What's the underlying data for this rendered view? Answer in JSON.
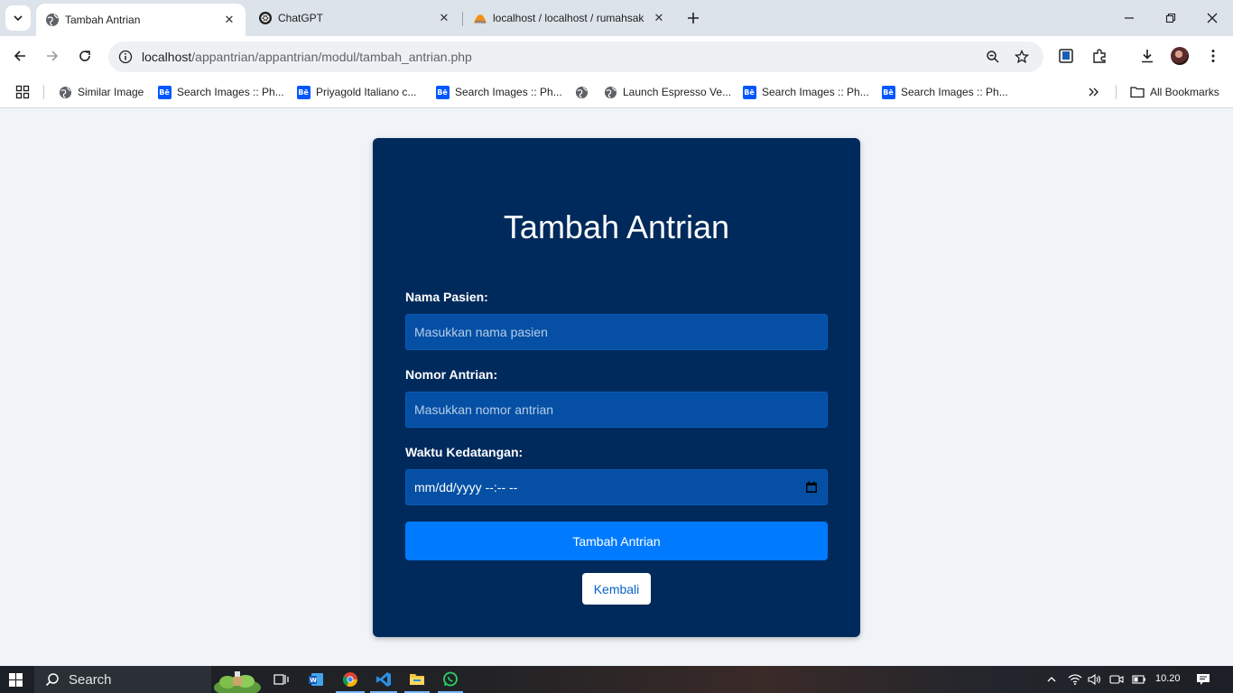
{
  "browser": {
    "tabs": [
      {
        "title": "Tambah Antrian",
        "active": true,
        "icon": "globe-icon"
      },
      {
        "title": "ChatGPT",
        "active": false,
        "icon": "chatgpt-icon"
      },
      {
        "title": "localhost / localhost / rumahsakit",
        "active": false,
        "icon": "phpmyadmin-icon"
      }
    ],
    "url_host": "localhost",
    "url_path": "/appantrian/appantrian/modul/tambah_antrian.php",
    "bookmarks": [
      {
        "label": "Similar Image",
        "icon": "globe-icon"
      },
      {
        "label": "Search Images :: Ph...",
        "icon": "behance-icon"
      },
      {
        "label": "Priyagold Italiano c...",
        "icon": "behance-icon"
      },
      {
        "label": "Search Images :: Ph...",
        "icon": "behance-icon"
      },
      {
        "label": "",
        "icon": "globe-icon"
      },
      {
        "label": "Launch Espresso Ve...",
        "icon": "globe-icon"
      },
      {
        "label": "Search Images :: Ph...",
        "icon": "behance-icon"
      },
      {
        "label": "Search Images :: Ph...",
        "icon": "behance-icon"
      }
    ],
    "all_bookmarks": "All Bookmarks"
  },
  "form": {
    "title": "Tambah Antrian",
    "nama_label": "Nama Pasien:",
    "nama_placeholder": "Masukkan nama pasien",
    "nomor_label": "Nomor Antrian:",
    "nomor_placeholder": "Masukkan nomor antrian",
    "waktu_label": "Waktu Kedatangan:",
    "waktu_value": "mm/dd/yyyy --:-- --",
    "submit_label": "Tambah Antrian",
    "back_label": "Kembali"
  },
  "taskbar": {
    "search_label": "Search",
    "clock": "10.20"
  },
  "colors": {
    "card_bg": "#002a5c",
    "input_bg": "#0550a4",
    "primary": "#007bff",
    "page_bg": "#f0f3f8"
  }
}
